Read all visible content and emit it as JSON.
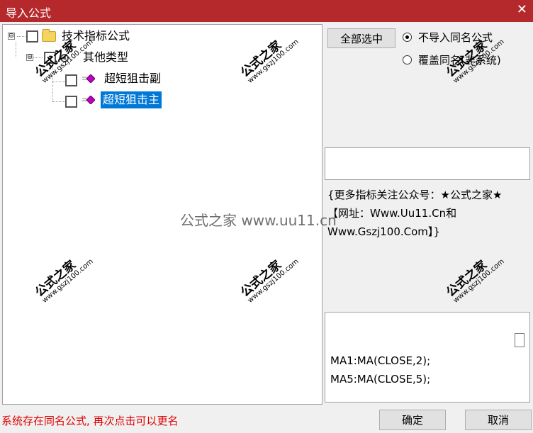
{
  "window": {
    "title": "导入公式",
    "close_glyph": "✕"
  },
  "tree": {
    "root": {
      "label": "技术指标公式",
      "expander": "⊟"
    },
    "group": {
      "label": "其他类型",
      "expander": "⊟"
    },
    "items": [
      {
        "label": "超短狙击副",
        "selected": false
      },
      {
        "label": "超短狙击主",
        "selected": true
      }
    ]
  },
  "controls": {
    "select_all": "全部选中",
    "radio_options": [
      {
        "label": "不导入同名公式",
        "checked": true
      },
      {
        "label": "覆盖同名(非系统)",
        "checked": false
      }
    ]
  },
  "description": "{更多指标关注公众号：★公式之家★ 【网址：Www.Uu11.Cn和Www.Gszj100.Com】}",
  "code_lines": [
    "MA1:MA(CLOSE,2);",
    "MA5:MA(CLOSE,5);"
  ],
  "status_text": "系统存在同名公式, 再次点击可以更名",
  "buttons": {
    "ok": "确定",
    "cancel": "取消"
  },
  "watermark": {
    "brand": "公式之家",
    "site": "www.gszj100.com",
    "center": "公式之家 www.uu11.cn"
  },
  "colors": {
    "titlebar": "#b5282c",
    "selection": "#0078d7",
    "status": "#e00000"
  }
}
